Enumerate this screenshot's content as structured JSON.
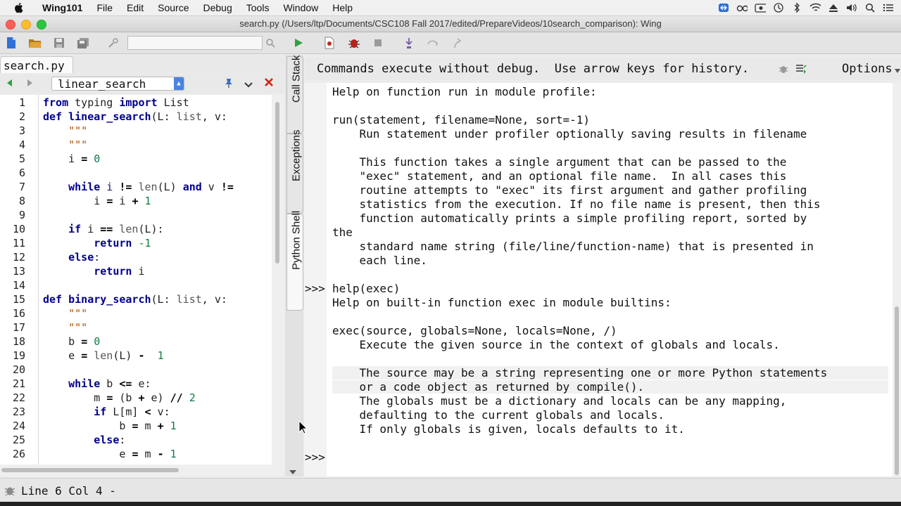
{
  "menubar": {
    "app": "Wing101",
    "items": [
      "File",
      "Edit",
      "Source",
      "Debug",
      "Tools",
      "Window",
      "Help"
    ]
  },
  "window": {
    "title": "search.py (/Users/ltp/Documents/CSC108 Fall 2017/edited/PrepareVideos/10search_comparison): Wing"
  },
  "toolbar": {
    "search_placeholder": ""
  },
  "editor": {
    "tab_label": "search.py",
    "function_select": "linear_search",
    "line_numbers": [
      "1",
      "2",
      "3",
      "4",
      "5",
      "6",
      "7",
      "8",
      "9",
      "10",
      "11",
      "12",
      "13",
      "14",
      "15",
      "16",
      "17",
      "18",
      "19",
      "20",
      "21",
      "22",
      "23",
      "24",
      "25",
      "26"
    ]
  },
  "side_tabs": {
    "call_stack": "Call Stack",
    "exceptions": "Exceptions",
    "python_shell": "Python Shell"
  },
  "shell": {
    "header_message": "Commands execute without debug.  Use arrow keys for history.",
    "options_label": "Options",
    "prompt": ">>>",
    "lines": [
      "Help on function run in module profile:",
      "",
      "run(statement, filename=None, sort=-1)",
      "    Run statement under profiler optionally saving results in filename",
      "",
      "    This function takes a single argument that can be passed to the",
      "    \"exec\" statement, and an optional file name.  In all cases this",
      "    routine attempts to \"exec\" its first argument and gather profiling",
      "    statistics from the execution. If no file name is present, then this",
      "    function automatically prints a simple profiling report, sorted by",
      "the",
      "    standard name string (file/line/function-name) that is presented in",
      "    each line.",
      "",
      "help(exec)",
      "Help on built-in function exec in module builtins:",
      "",
      "exec(source, globals=None, locals=None, /)",
      "    Execute the given source in the context of globals and locals.",
      "",
      "    The source may be a string representing one or more Python statements",
      "    or a code object as returned by compile().",
      "    The globals must be a dictionary and locals can be any mapping,",
      "    defaulting to the current globals and locals.",
      "    If only globals is given, locals defaults to it."
    ]
  },
  "status": {
    "text": "Line 6 Col 4 -"
  },
  "colors": {
    "accent": "#4a84e0",
    "keyword": "#00008b",
    "number": "#097f3f"
  }
}
